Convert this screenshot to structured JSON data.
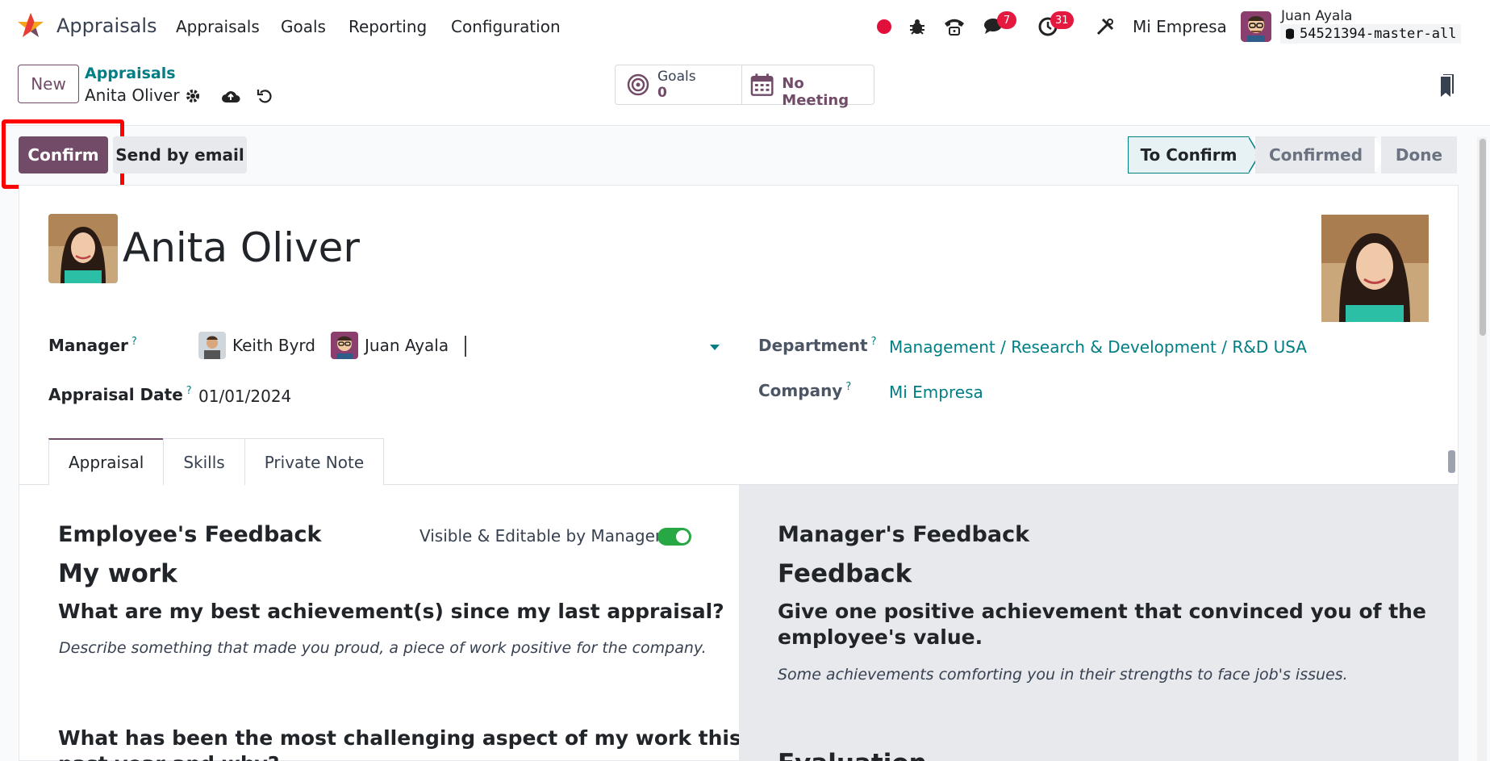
{
  "navbar": {
    "app_name": "Appraisals",
    "menu": [
      "Appraisals",
      "Goals",
      "Reporting",
      "Configuration"
    ],
    "messages_count": "7",
    "activities_count": "31",
    "company": "Mi Empresa",
    "user_name": "Juan Ayala",
    "database": "54521394-master-all"
  },
  "control": {
    "new_label": "New",
    "breadcrumb_parent": "Appraisals",
    "breadcrumb_current": "Anita Oliver",
    "goals_label": "Goals",
    "goals_value": "0",
    "meeting_label": "No Meeting"
  },
  "statusbar": {
    "confirm_label": "Confirm",
    "email_label": "Send by email",
    "stages": [
      "To Confirm",
      "Confirmed",
      "Done"
    ],
    "active_stage": "To Confirm"
  },
  "form": {
    "employee_name": "Anita Oliver",
    "manager_label": "Manager",
    "managers": [
      "Keith Byrd",
      "Juan Ayala"
    ],
    "appraisal_date_label": "Appraisal Date",
    "appraisal_date": "01/01/2024",
    "department_label": "Department",
    "department": "Management / Research & Development / R&D USA",
    "company_label": "Company",
    "company": "Mi Empresa",
    "help_mark": "?",
    "tabs": [
      "Appraisal",
      "Skills",
      "Private Note"
    ]
  },
  "employee_feedback": {
    "title": "Employee's Feedback",
    "toggle_label": "Visible & Editable by Manager",
    "section": "My work",
    "question1": "What are my best achievement(s) since my last appraisal?",
    "hint1": "Describe something that made you proud, a piece of work positive for the company.",
    "question2_line1": "What has been the most challenging aspect of my work this",
    "question2_line2": "past year and why?"
  },
  "manager_feedback": {
    "title": "Manager's Feedback",
    "section": "Feedback",
    "question1_line1": "Give one positive achievement that convinced you of the",
    "question1_line2": "employee's value.",
    "hint1": "Some achievements comforting you in their strengths to face job's issues.",
    "section2": "Evaluation"
  },
  "colors": {
    "brand": "#714b67",
    "link": "#017e84",
    "highlight": "#ff0000",
    "badge": "#e5193f"
  }
}
